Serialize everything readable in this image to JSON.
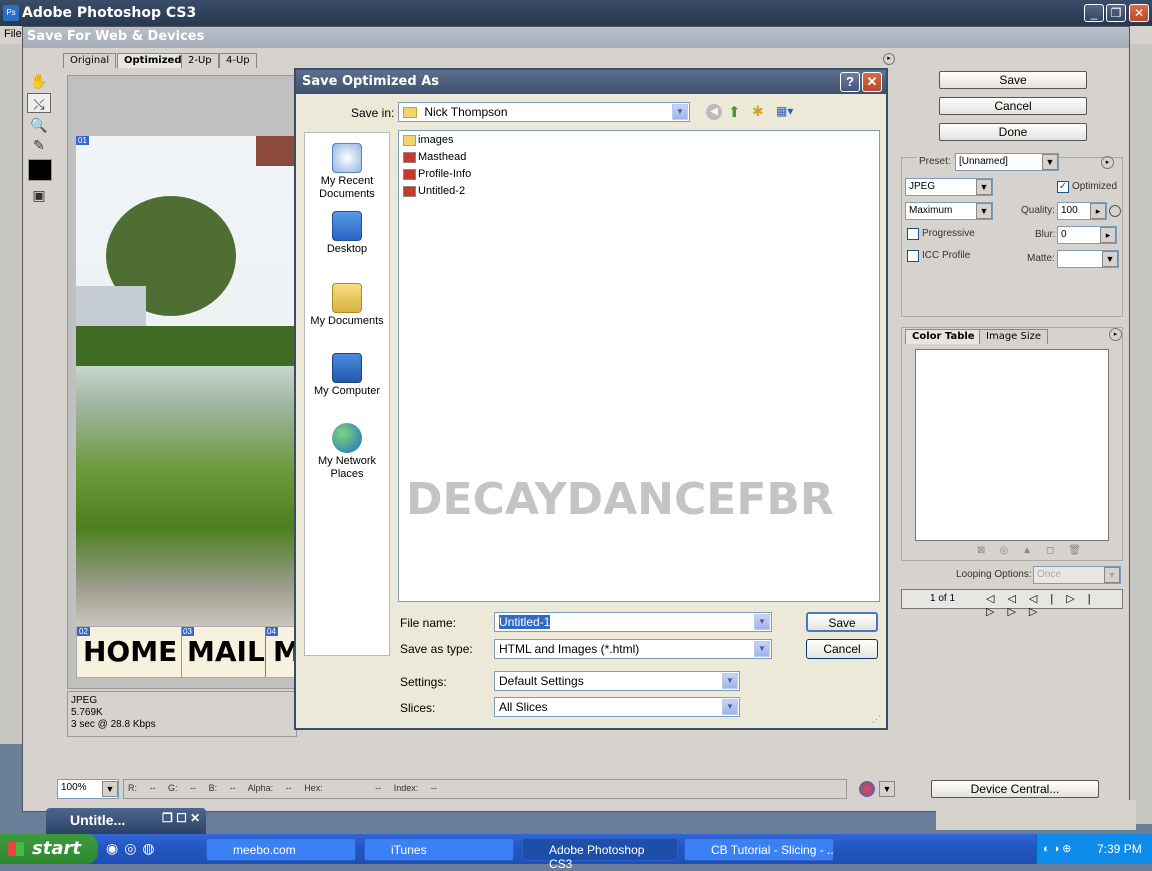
{
  "ps": {
    "title": "Adobe Photoshop CS3",
    "menu_first": "File",
    "win_min": "_",
    "win_max": "❐",
    "win_close": "✕"
  },
  "sfw": {
    "title": "Save For Web & Devices",
    "tabs": [
      "Original",
      "Optimized",
      "2-Up",
      "4-Up"
    ],
    "info": {
      "format": "JPEG",
      "size": "5.769K",
      "time": "3 sec @ 28.8 Kbps"
    },
    "slices": {
      "n1": "01",
      "n2": "02",
      "n3": "03",
      "n4": "04",
      "w1": "HOME",
      "w2": "MAIL",
      "w3": "M"
    },
    "buttons": {
      "save": "Save",
      "cancel": "Cancel",
      "done": "Done"
    },
    "preset_label": "Preset:",
    "preset_value": "[Unnamed]",
    "format": "JPEG",
    "optimized_label": "Optimized",
    "quality_mode": "Maximum",
    "quality_label": "Quality:",
    "quality_value": "100",
    "progressive_label": "Progressive",
    "blur_label": "Blur:",
    "blur_value": "0",
    "icc_label": "ICC Profile",
    "matte_label": "Matte:",
    "panel_tabs": [
      "Color Table",
      "Image Size"
    ],
    "looping_label": "Looping Options:",
    "looping_value": "Once",
    "frame_counter": "1 of 1",
    "device_central": "Device Central...",
    "zoom": "100%",
    "readout": {
      "r": "R:",
      "r_v": "--",
      "g": "G:",
      "g_v": "--",
      "b": "B:",
      "b_v": "--",
      "alpha": "Alpha:",
      "alpha_v": "--",
      "hex": "Hex:",
      "hex_v": "--",
      "index": "Index:",
      "index_v": "--"
    }
  },
  "save": {
    "title": "Save Optimized As",
    "help": "?",
    "close": "✕",
    "save_in_label": "Save in:",
    "save_in_value": "Nick Thompson",
    "places": [
      "My Recent Documents",
      "Desktop",
      "My Documents",
      "My Computer",
      "My Network Places"
    ],
    "files": [
      "images",
      "Masthead",
      "Profile-Info",
      "Untitled-2"
    ],
    "watermark": "DECAYDANCEFBR",
    "filename_label": "File name:",
    "filename_value": "Untitled-1",
    "type_label": "Save as type:",
    "type_value": "HTML and Images (*.html)",
    "settings_label": "Settings:",
    "settings_value": "Default Settings",
    "slices_label": "Slices:",
    "slices_value": "All Slices",
    "save_btn": "Save",
    "cancel_btn": "Cancel"
  },
  "taskbar": {
    "start": "start",
    "mini_window": "Untitle...",
    "tasks": [
      "meebo.com",
      "iTunes",
      "Adobe Photoshop CS3",
      "CB Tutorial - Slicing - ..."
    ],
    "clock": "7:39 PM"
  },
  "colors": {
    "title_bar": "#3a4d68",
    "dialog_bg": "#d6d3ce",
    "xp_taskbar": "#2457c5",
    "start_green": "#3c9a3c"
  }
}
